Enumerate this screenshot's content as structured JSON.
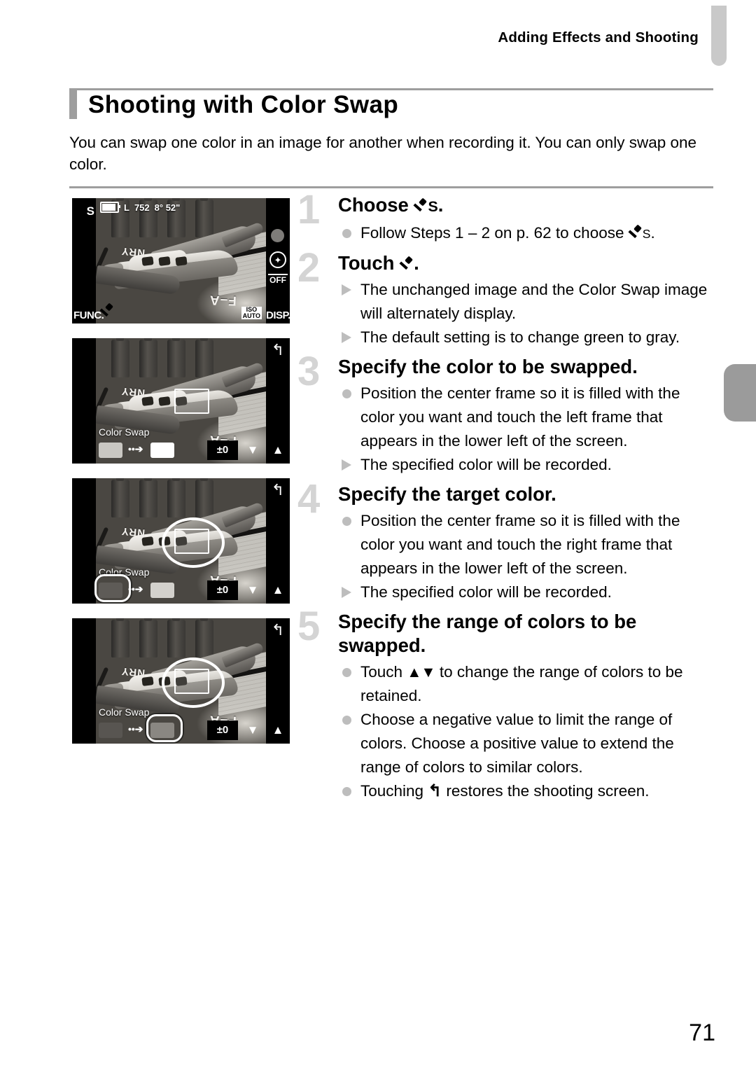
{
  "header": {
    "running_head": "Adding Effects and Shooting"
  },
  "title": "Shooting with Color Swap",
  "intro": "You can swap one color in an image for another when recording it. You can only swap one color.",
  "steps": [
    {
      "number": "1",
      "heading_pre": "Choose ",
      "heading_icon": "eyedropper-s-icon",
      "heading_post": ".",
      "bullets": [
        {
          "marker": "dot",
          "pre": "Follow Steps 1 – 2 on p. 62 to choose ",
          "icon": "eyedropper-s-icon",
          "post": "."
        }
      ]
    },
    {
      "number": "2",
      "heading_pre": "Touch ",
      "heading_icon": "eyedropper-icon",
      "heading_post": ".",
      "bullets": [
        {
          "marker": "triangle",
          "pre": "The unchanged image and the Color Swap image will alternately display.",
          "icon": "",
          "post": ""
        },
        {
          "marker": "triangle",
          "pre": "The default setting is to change green to gray.",
          "icon": "",
          "post": ""
        }
      ]
    },
    {
      "number": "3",
      "heading_pre": "Specify the color to be swapped.",
      "heading_icon": "",
      "heading_post": "",
      "bullets": [
        {
          "marker": "dot",
          "pre": "Position the center frame so it is filled with the color you want and touch the left frame that appears in the lower left of the screen.",
          "icon": "",
          "post": ""
        },
        {
          "marker": "triangle",
          "pre": "The specified color will be recorded.",
          "icon": "",
          "post": ""
        }
      ]
    },
    {
      "number": "4",
      "heading_pre": "Specify the target color.",
      "heading_icon": "",
      "heading_post": "",
      "bullets": [
        {
          "marker": "dot",
          "pre": "Position the center frame so it is filled with the color you want and touch the right frame that appears in the lower left of the screen.",
          "icon": "",
          "post": ""
        },
        {
          "marker": "triangle",
          "pre": "The specified color will be recorded.",
          "icon": "",
          "post": ""
        }
      ]
    },
    {
      "number": "5",
      "heading_pre": "Specify the range of colors to be swapped.",
      "heading_icon": "",
      "heading_post": "",
      "bullets": [
        {
          "marker": "dot",
          "pre": "Touch ",
          "icon": "up-down-arrows-icon",
          "icon_glyph": "▲▼",
          "post": " to change the range of colors to be retained."
        },
        {
          "marker": "dot",
          "pre": "Choose a negative value to limit the range of colors. Choose a positive value to extend the range of colors to similar colors.",
          "icon": "",
          "post": ""
        },
        {
          "marker": "dot",
          "pre": "Touching ",
          "icon": "back-arrow-icon",
          "icon_glyph": "↰",
          "post": " restores the shooting screen."
        }
      ]
    }
  ],
  "screens": [
    {
      "name": "shooting-screen",
      "mode_badge": "S",
      "func_label": "FUNC.",
      "disp_label": "DISP.",
      "osd_quality": "L",
      "osd_shots": "752",
      "osd_time": "8° 52\"",
      "iso_line1": "ISO",
      "iso_line2": "AUTO",
      "flash_glyph": "✦",
      "off_label": "OFF"
    },
    {
      "name": "color-swap-screen-initial",
      "back_glyph": "↰",
      "label": "Color Swap",
      "value": "±0",
      "down_glyph": "▼",
      "up_glyph": "▲",
      "arrow_glyph": "••➔",
      "swatch_left": "#c9c7c2",
      "swatch_right": "#ffffff",
      "highlight": "none"
    },
    {
      "name": "color-swap-screen-source-selected",
      "back_glyph": "↰",
      "label": "Color Swap",
      "value": "±0",
      "down_glyph": "▼",
      "up_glyph": "▲",
      "arrow_glyph": "••➔",
      "swatch_left": "#5e5b57",
      "swatch_right": "#d3d1cc",
      "highlight": "left"
    },
    {
      "name": "color-swap-screen-target-selected",
      "back_glyph": "↰",
      "label": "Color Swap",
      "value": "±0",
      "down_glyph": "▼",
      "up_glyph": "▲",
      "arrow_glyph": "••➔",
      "swatch_left": "#585551",
      "swatch_right": "#8a8782",
      "highlight": "right"
    }
  ],
  "plane_markings": {
    "top": "NRY",
    "side": "F–A"
  },
  "page_number": "71",
  "colors": {
    "rule": "#9e9e9e",
    "step_number": "#d4d4d4",
    "bullet": "#bdbdbd",
    "tab_top": "#c9c9c9",
    "tab_mid": "#9b9b9b"
  }
}
